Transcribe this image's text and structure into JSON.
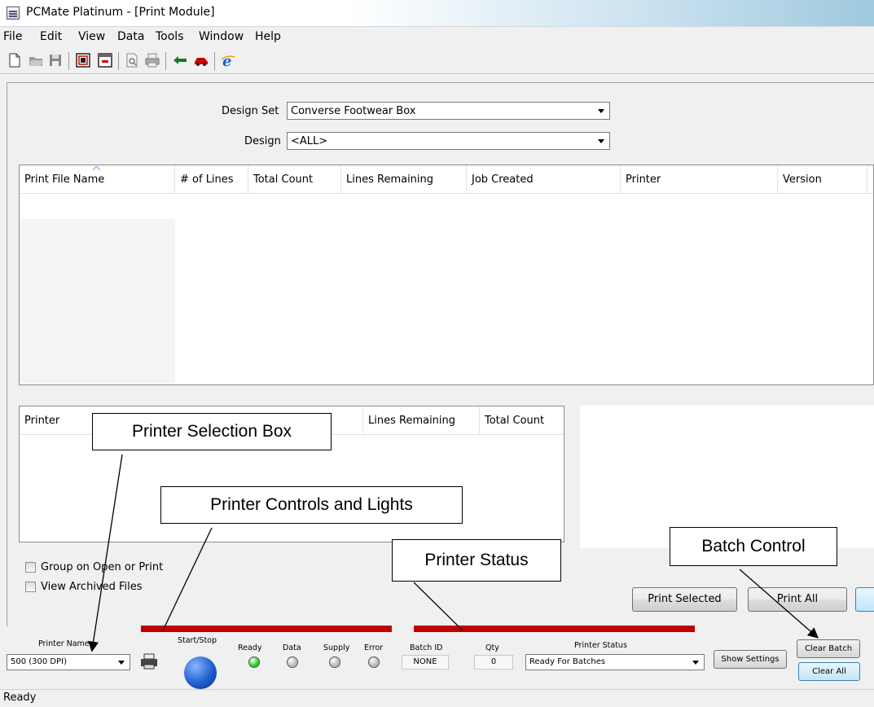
{
  "window": {
    "title": "PCMate Platinum - [Print Module]"
  },
  "menu": [
    "File",
    "Edit",
    "View",
    "Data",
    "Tools",
    "Window",
    "Help"
  ],
  "toolbar": {
    "icons": [
      "new-file-icon",
      "open-folder-icon",
      "save-icon",
      "design-icon",
      "form-icon",
      "print-preview-icon",
      "print-icon",
      "back-arrow-icon",
      "car-icon",
      "browser-icon"
    ]
  },
  "filters": {
    "design_set_label": "Design Set",
    "design_set_value": "Converse Footwear Box",
    "design_label": "Design",
    "design_value": "<ALL>"
  },
  "print_files_table": {
    "columns": [
      "Print File Name",
      "# of Lines",
      "Total Count",
      "Lines Remaining",
      "Job Created",
      "Printer",
      "Version"
    ],
    "rows": []
  },
  "printer_table": {
    "columns": [
      "Printer",
      "",
      "Lines Remaining",
      "Total Count"
    ],
    "rows": []
  },
  "options": {
    "group_on_open": "Group on Open or Print",
    "view_archived": "View Archived Files"
  },
  "buttons": {
    "print_selected": "Print Selected",
    "print_all": "Print All",
    "show_settings": "Show Settings",
    "clear_batch": "Clear Batch",
    "clear_all": "Clear All"
  },
  "printer_panel": {
    "printer_name_label": "Printer Name",
    "printer_name_value": "500 (300 DPI)",
    "start_stop_label": "Start/Stop",
    "lights": [
      {
        "label": "Ready",
        "color": "#22cc22"
      },
      {
        "label": "Data",
        "color": "#b8b8b8"
      },
      {
        "label": "Supply",
        "color": "#b8b8b8"
      },
      {
        "label": "Error",
        "color": "#b8b8b8"
      }
    ],
    "batch_id_label": "Batch ID",
    "batch_id_value": "NONE",
    "qty_label": "Qty",
    "qty_value": "0",
    "printer_status_label": "Printer Status",
    "printer_status_value": "Ready For Batches"
  },
  "callouts": {
    "printer_selection": "Printer Selection Box",
    "printer_controls": "Printer Controls and Lights",
    "batch_control": "Batch Control",
    "printer_status": "Printer Status"
  },
  "status_bar": {
    "text": "Ready"
  },
  "colors": {
    "accent_bar": "#c00000",
    "start_button": "#1f5fd0",
    "ready_light": "#22cc22"
  }
}
